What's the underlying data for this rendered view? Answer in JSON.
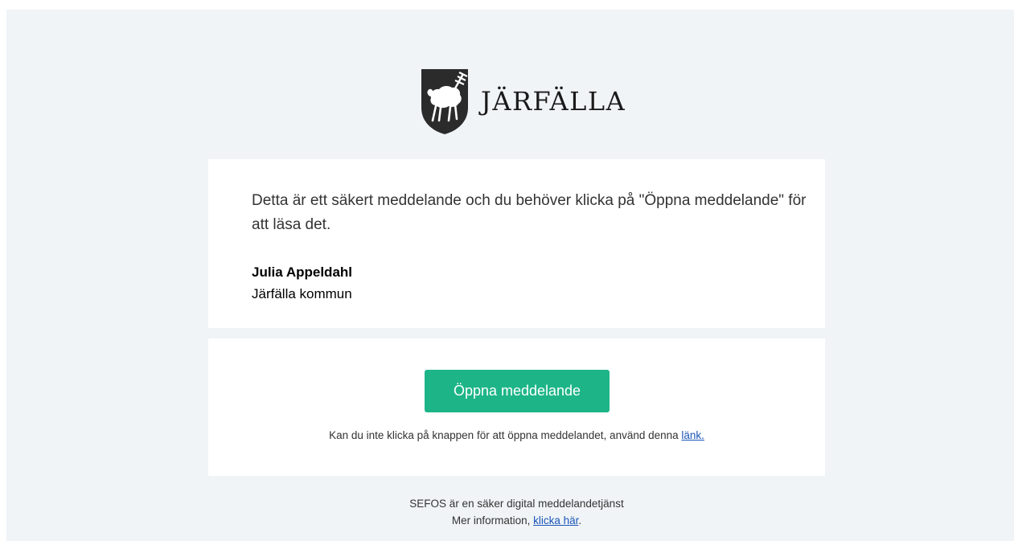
{
  "header": {
    "logo_icon": "jarfalla-coat-of-arms-icon",
    "logo_text": "JÄRFÄLLA"
  },
  "message": {
    "text": "Detta är ett säkert meddelande och du behöver klicka på \"Öppna meddelande\" för att läsa det.",
    "sender_name": "Julia Appeldahl",
    "sender_org": "Järfälla kommun"
  },
  "action": {
    "button_label": "Öppna meddelande",
    "fallback_prefix": "Kan du inte klicka på knappen för att öppna meddelandet, använd denna ",
    "fallback_link": "länk."
  },
  "footer": {
    "line1": "SEFOS är en säker digital meddelandetjänst",
    "line2_prefix": "Mer information, ",
    "line2_link": "klicka här",
    "line2_suffix": "."
  },
  "colors": {
    "background": "#f0f4f7",
    "card": "#ffffff",
    "button": "#1db588",
    "link": "#1a56b8"
  }
}
